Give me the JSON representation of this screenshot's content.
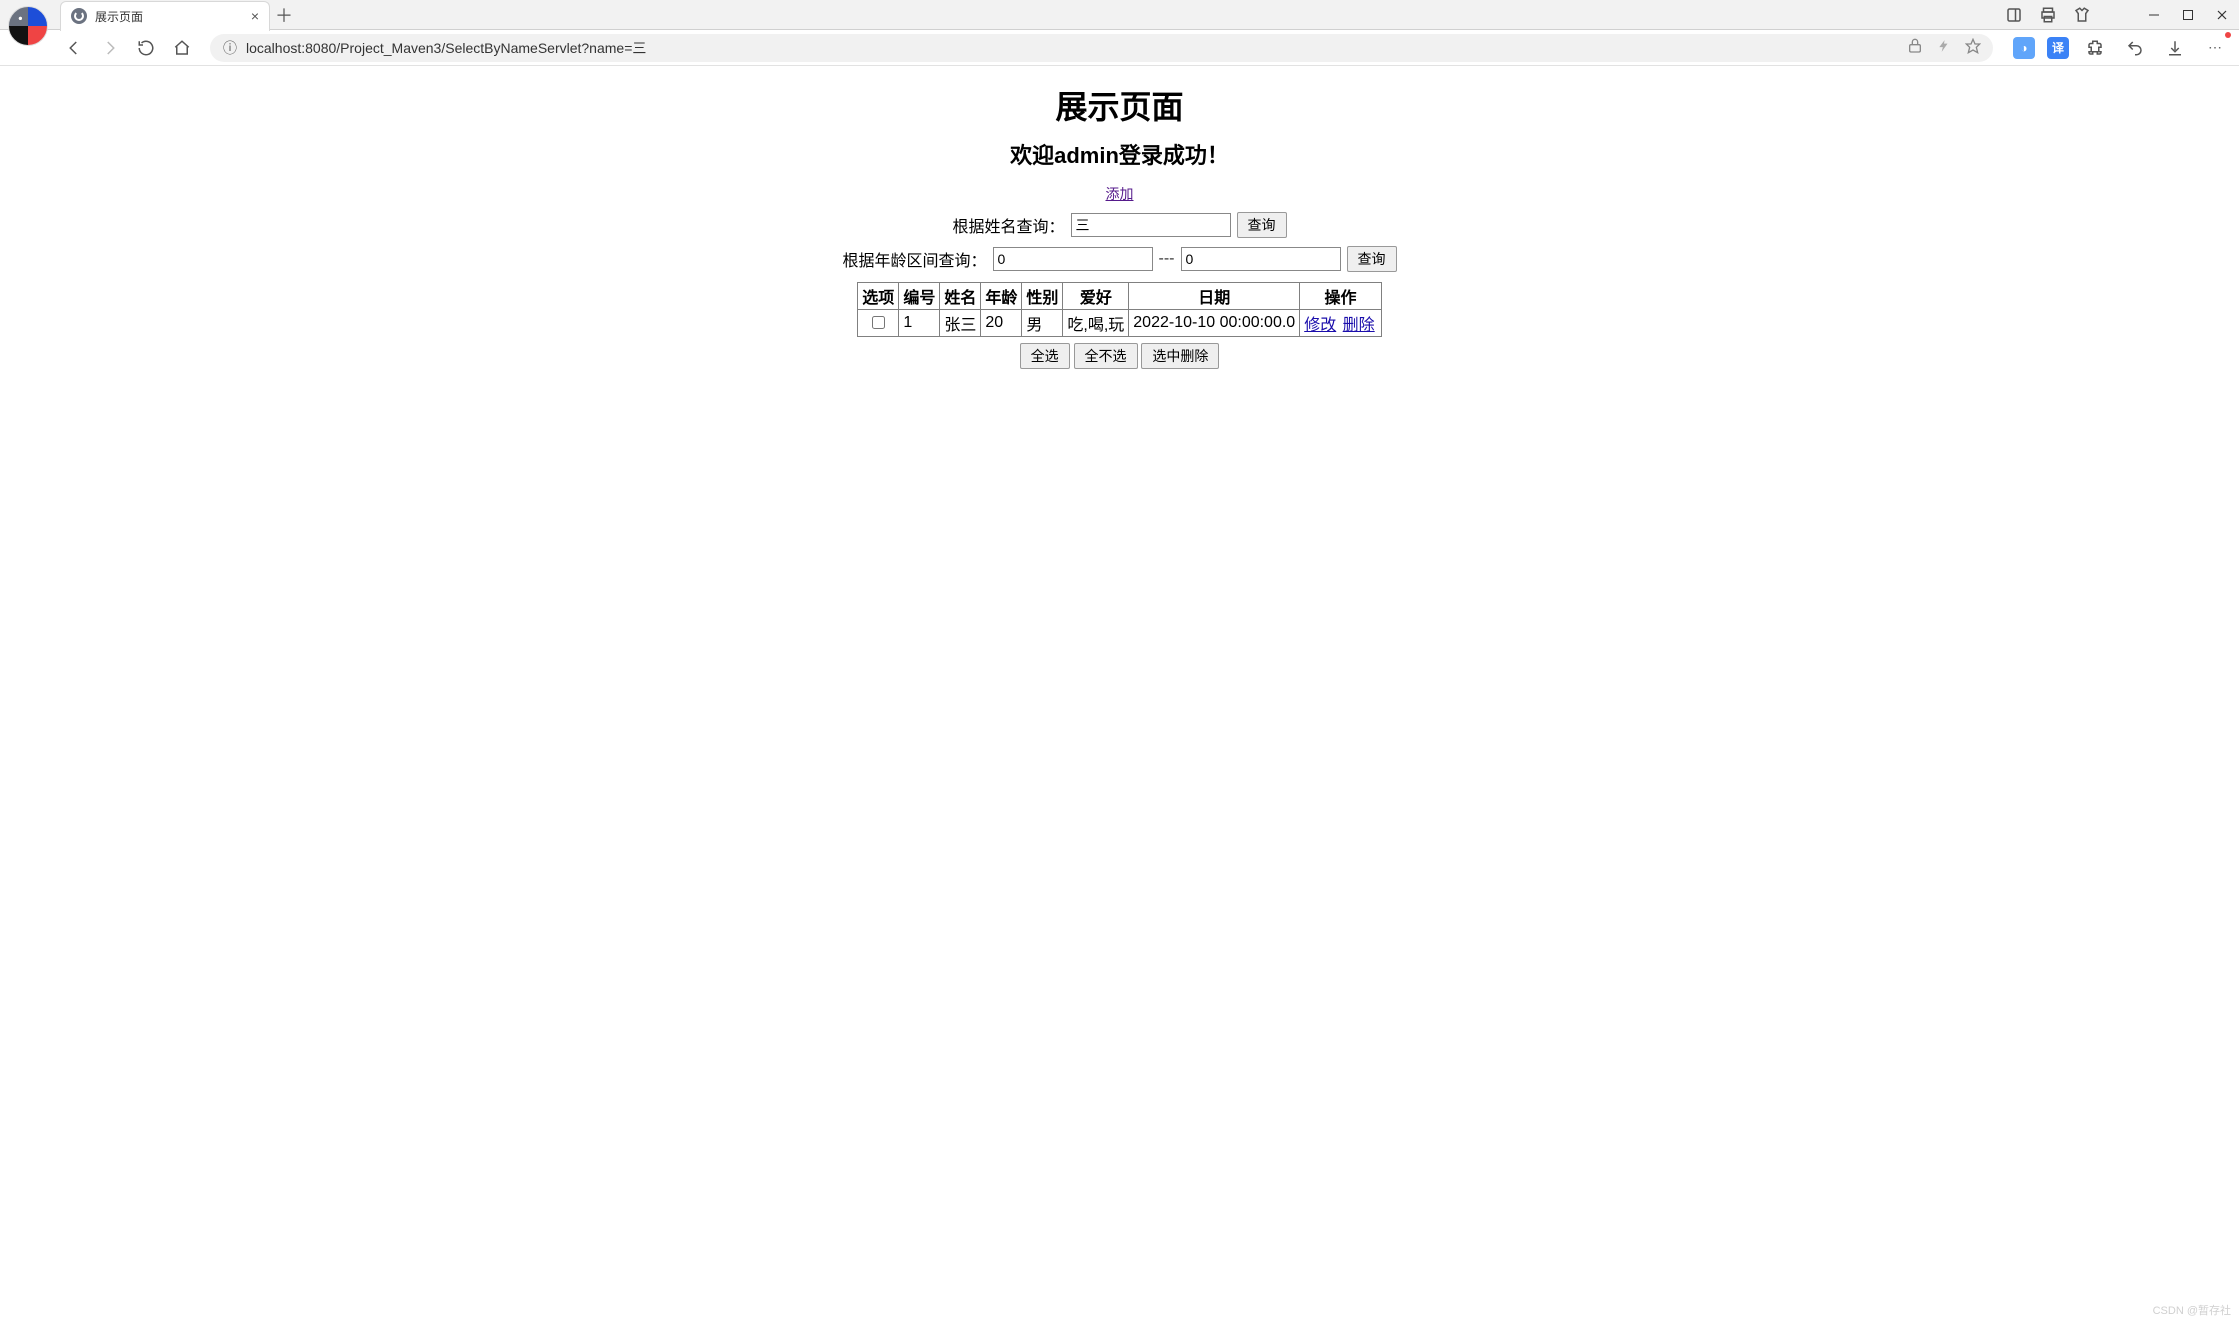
{
  "browser": {
    "tab_title": "展示页面",
    "url": "localhost:8080/Project_Maven3/SelectByNameServlet?name=三"
  },
  "page": {
    "title": "展示页面",
    "welcome": "欢迎admin登录成功！",
    "add_link": "添加",
    "name_search": {
      "label": "根据姓名查询：",
      "value": "三",
      "button": "查询"
    },
    "age_search": {
      "label": "根据年龄区间查询：",
      "from": "0",
      "separator": "---",
      "to": "0",
      "button": "查询"
    },
    "table": {
      "headers": {
        "checkbox": "选项",
        "id": "编号",
        "name": "姓名",
        "age": "年龄",
        "gender": "性别",
        "hobby": "爱好",
        "date": "日期",
        "ops": "操作"
      },
      "rows": [
        {
          "id": "1",
          "name": "张三",
          "age": "20",
          "gender": "男",
          "hobby": "吃,喝,玩",
          "date": "2022-10-10 00:00:00.0",
          "edit": "修改",
          "delete": "删除"
        }
      ]
    },
    "batch": {
      "select_all": "全选",
      "select_none": "全不选",
      "delete_selected": "选中删除"
    }
  },
  "watermark": "CSDN @暂存社"
}
